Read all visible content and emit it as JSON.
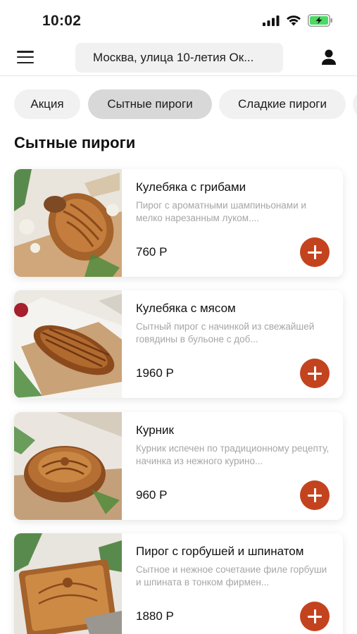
{
  "status_bar": {
    "time": "10:02",
    "icons": [
      "signal-icon",
      "wifi-icon",
      "battery-charging-icon"
    ],
    "battery_color": "#4cd964"
  },
  "header": {
    "address": "Москва, улица 10-летия Ок...",
    "icons": [
      "menu-icon",
      "profile-icon"
    ]
  },
  "tabs": [
    {
      "label": "Акция",
      "active": false
    },
    {
      "label": "Сытные пироги",
      "active": true
    },
    {
      "label": "Сладкие пироги",
      "active": false
    }
  ],
  "section": {
    "title": "Сытные пироги"
  },
  "products": [
    {
      "title": "Кулебяка с грибами",
      "description": "Пирог с ароматными шампиньонами и мелко нарезанным луком....",
      "price": "760 Р"
    },
    {
      "title": "Кулебяка с мясом",
      "description": "Сытный пирог с начинкой из свежайшей говядины в бульоне с доб...",
      "price": "1960 Р"
    },
    {
      "title": "Курник",
      "description": "Курник испечен по традиционному рецепту, начинка из нежного курино...",
      "price": "960 Р"
    },
    {
      "title": "Пирог с горбушей и шпинатом",
      "description": "Сытное и нежное сочетание филе горбуши и шпината в тонком фирмен...",
      "price": "1880 Р"
    }
  ],
  "colors": {
    "accent": "#c3431f",
    "tab_active": "#d8d8d9",
    "tab_inactive": "#f1f1f2",
    "description_text": "#a6a6a8"
  }
}
